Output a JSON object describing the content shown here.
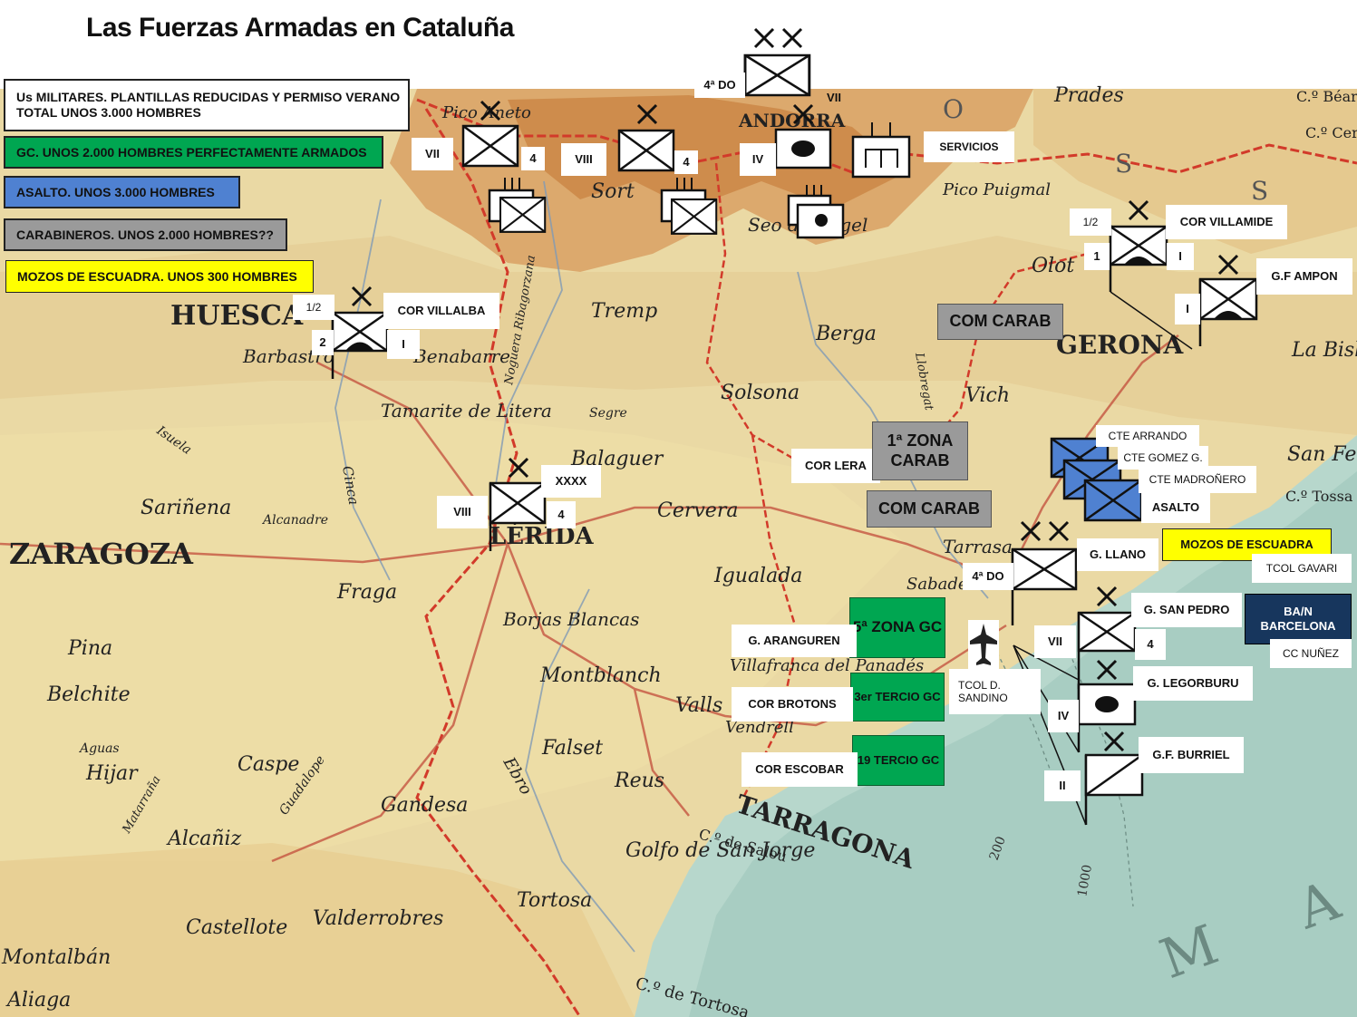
{
  "title": "Las Fuerzas Armadas en Cataluña",
  "legend": {
    "military": "Us MILITARES. PLANTILLAS REDUCIDAS Y PERMISO VERANO TOTAL UNOS 3.000 HOMBRES",
    "gc": "GC. UNOS 2.000 HOMBRES PERFECTAMENTE ARMADOS",
    "asalto": "ASALTO. UNOS 3.000 HOMBRES",
    "carabineros": "CARABINEROS. UNOS 2.000 HOMBRES??",
    "mozos": "MOZOS DE ESCUADRA. UNOS 300 HOMBRES"
  },
  "colors": {
    "gc": "#00a651",
    "asalto": "#4f81d1",
    "carabineros": "#9a9a9a",
    "mozos": "#ffff00",
    "navy": "#17365d"
  },
  "map_labels": {
    "huesca": "HUESCA",
    "barbastro": "Barbastro",
    "benabarre": "Benabarre",
    "tamarite": "Tamarite de Litera",
    "sarinena": "Sariñena",
    "zaragoza": "ZARAGOZA",
    "pina": "Pina",
    "belchite": "Belchite",
    "hijar": "Hijar",
    "caspe": "Caspe",
    "alcaniz": "Alcañiz",
    "castellote": "Castellote",
    "montalban": "Montalbán",
    "aliaga": "Aliaga",
    "valderrobres": "Valderrobres",
    "gandesa": "Gandesa",
    "fraga": "Fraga",
    "lerida": "LÉRIDA",
    "borjas": "Borjas Blancas",
    "balaguer": "Balaguer",
    "cervera": "Cervera",
    "igualada": "Igualada",
    "montblanch": "Montblanch",
    "valls": "Valls",
    "falset": "Falset",
    "reus": "Reus",
    "tarragona": "TARRAGONA",
    "golfo": "Golfo de San Jorge",
    "tortosa": "Tortosa",
    "salou": "C.º de Salou",
    "tortosa_cabo": "C.º de Tortosa",
    "tremp": "Tremp",
    "sort": "Sort",
    "seo": "Seo de Urgel",
    "andorra": "ANDORRA",
    "solsona": "Solsona",
    "berga": "Berga",
    "vich": "Vich",
    "gerona": "GERONA",
    "olot": "Olot",
    "prades": "Prades",
    "tarrasa": "Tarrasa",
    "sabadell": "Sabadell",
    "villafranca": "Villafranca del Panadés",
    "vendrell": "Vendrell",
    "la_bisbal": "La Bisb",
    "san_feliu": "San Fe",
    "tossa": "C.º Tossa",
    "puigmal": "Pico Puigmal",
    "aneto": "Pico Aneto",
    "ebro": "Ebro",
    "cinca": "Cinca",
    "isuela": "Isuela",
    "alcanadre": "Alcanadre",
    "segre": "Segre",
    "noguera": "Noguera Ribagorzana",
    "llobregat": "Llobregat",
    "guadalope": "Guadalope",
    "aguas": "Aguas",
    "matarrana": "Matarraña",
    "mar": "M A R",
    "c200": "200",
    "c1000": "1000",
    "cbear": "C.º Béar",
    "ccer": "C.º Cer",
    "s_letter": "S",
    "o_letter": "O",
    "s2_letter": "S"
  },
  "units": {
    "do_top": "4ª DO",
    "do_mid": "4ª DO",
    "servicios": "SERVICIOS",
    "vii_1": "VII",
    "n4_1": "4",
    "viii_1": "VIII",
    "n4_2": "4",
    "iv_1": "IV",
    "vii_andorra": "VII",
    "half_villalba": "1/2",
    "cor_villalba": "COR VILLALBA",
    "n2": "2",
    "i_villalba": "I",
    "half_villamide": "1/2",
    "cor_villamide": "COR VILLAMIDE",
    "n1": "1",
    "i_villamide": "I",
    "gf_ampon": "G.F AMPON",
    "i_ampon": "I",
    "com_carab_1": "COM CARAB",
    "viii_lerida": "VIII",
    "xxxx": "XXXX",
    "n4_lerida": "4",
    "cor_lera": "COR LERA",
    "zona1": "1ª ZONA CARAB",
    "com_carab_2": "COM CARAB",
    "cte_arrando": "CTE ARRANDO",
    "cte_gomez": "CTE GOMEZ G.",
    "cte_madronero": "CTE MADROÑERO",
    "asalto": "ASALTO",
    "mozos": "MOZOS DE ESCUADRA",
    "tcol_gavari": "TCOL GAVARI",
    "g_llano": "G. LLANO",
    "g_san_pedro": "G. SAN PEDRO",
    "vii_bcn": "VII",
    "n4_bcn": "4",
    "ban": "BA/N BARCELONA",
    "cc_nunez": "CC NUÑEZ",
    "zona5": "5ª ZONA GC",
    "g_aranguren": "G. ARANGUREN",
    "tcol_sandino": "TCOL D. SANDINO",
    "tercio3": "3er TERCIO GC",
    "cor_brotons": "COR BROTONS",
    "g_legorburu": "G. LEGORBURU",
    "iv_bcn": "IV",
    "tercio19": "19 TERCIO GC",
    "cor_escobar": "COR ESCOBAR",
    "gf_burriel": "G.F. BURRIEL",
    "ii_bcn": "II"
  }
}
